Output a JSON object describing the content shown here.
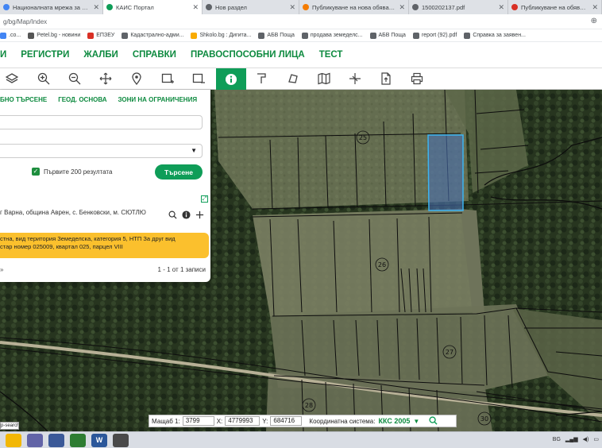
{
  "browser": {
    "tabs": [
      {
        "title": "Националната мрежа за земед...",
        "color": "#4285f4",
        "active": false
      },
      {
        "title": "КАИС Портал",
        "color": "#0f9d58",
        "active": true
      },
      {
        "title": "Нов раздел",
        "color": "#5f6368",
        "active": false
      },
      {
        "title": "Публикуване на нова обява в ...",
        "color": "#f57c00",
        "active": false
      },
      {
        "title": "1500202137.pdf",
        "color": "#5f6368",
        "active": false
      },
      {
        "title": "Публикуване на обява - Продаж...",
        "color": "#d93025",
        "active": false
      }
    ],
    "new_tab_label": "+",
    "url": "g/bg/Map/Index",
    "bookmarks": [
      {
        "label": ".co...",
        "color": "#4285f4"
      },
      {
        "label": "Petel.bg - новини",
        "color": "#555555"
      },
      {
        "label": "ЕПЗЕУ",
        "color": "#d93025"
      },
      {
        "label": "Кадастрално-адми...",
        "color": "#5f6368"
      },
      {
        "label": "Shkolo.bg : Дигита...",
        "color": "#f9ab00"
      },
      {
        "label": "АБВ Поща",
        "color": "#5f6368"
      },
      {
        "label": "продава земеделс...",
        "color": "#5f6368"
      },
      {
        "label": "АБВ Поща",
        "color": "#5f6368"
      },
      {
        "label": "report (92).pdf",
        "color": "#5f6368"
      },
      {
        "label": "Справка за заявен...",
        "color": "#5f6368"
      }
    ]
  },
  "nav": {
    "items": [
      "И",
      "РЕГИСТРИ",
      "ЖАЛБИ",
      "СПРАВКИ",
      "ПРАВОСПОСОБНИ ЛИЦА",
      "ТЕСТ"
    ]
  },
  "toolbar": {
    "tools": [
      "layers-icon",
      "zoom-in-icon",
      "zoom-out-icon",
      "pan-icon",
      "location-pin-icon",
      "select-rectangle-icon",
      "deselect-rectangle-icon",
      "info-icon",
      "measure-length-icon",
      "measure-area-icon",
      "map-icon",
      "crosshair-icon",
      "export-icon",
      "print-icon"
    ],
    "active_tool": "info-icon"
  },
  "panel": {
    "tabs": [
      "БНО ТЪРСЕНЕ",
      "ГЕОД. ОСНОВА",
      "ЗОНИ НА ОГРАНИЧЕНИЯ"
    ],
    "first_200_label": "Първите 200 резултата",
    "search_label": "Търсене",
    "result_header": "г Варна, община Аврен, с. Бенковски, м. СЮТЛЮ",
    "result_line1": "стна, вид територия Земеделска, категория 5, НТП За друг вид",
    "result_line2": "стар номер 025009, квартал 025, парцел VIII",
    "pagination": "1 - 1 от 1 записи",
    "pager_icon": "»"
  },
  "map": {
    "parcel_labels": [
      "25",
      "26",
      "27",
      "28",
      "30"
    ],
    "highlight_color": "#4a8fd6"
  },
  "coords": {
    "scale_label": "Мащаб 1:",
    "scale_value": "3799",
    "x_label": "X:",
    "x_value": "4779993",
    "y_label": "Y:",
    "y_value": "684716",
    "system_label": "Координатна система:",
    "system_value": "ККС 2005"
  },
  "tooltip": "p-search",
  "taskbar": {
    "apps": [
      {
        "name": "file-explorer-icon",
        "color": "#f2b705",
        "label": ""
      },
      {
        "name": "teams-icon",
        "color": "#6264a7",
        "label": ""
      },
      {
        "name": "tool-icon",
        "color": "#3b5998",
        "label": ""
      },
      {
        "name": "calculator-icon",
        "color": "#2e7d32",
        "label": ""
      },
      {
        "name": "word-icon",
        "color": "#2b579a",
        "label": "W"
      },
      {
        "name": "chrome-icon",
        "color": "#4a4a4a",
        "label": ""
      }
    ],
    "lang": "BG"
  }
}
